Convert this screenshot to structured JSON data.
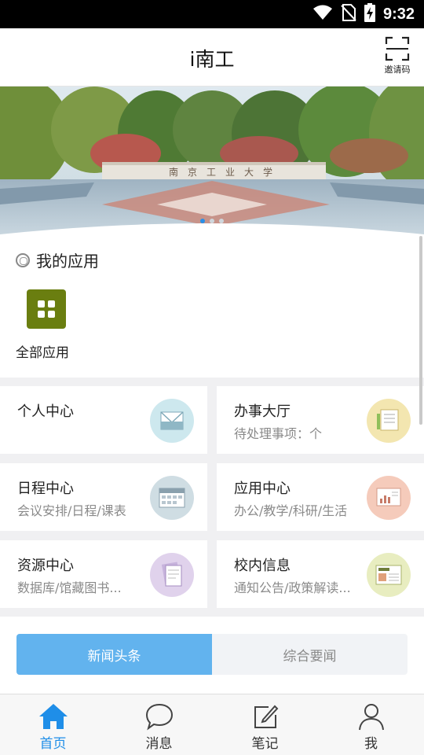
{
  "status_bar": {
    "time": "9:32"
  },
  "header": {
    "title": "i南工",
    "invite_label": "邀请码"
  },
  "banner": {
    "slide_count": 3,
    "active_index": 0
  },
  "my_apps": {
    "heading": "我的应用",
    "all_apps_label": "全部应用",
    "all_apps_color": "#6a7e10"
  },
  "cards": [
    {
      "title": "个人中心",
      "subtitle": "",
      "icon": "envelope-icon",
      "badge_color": "#cde8ee"
    },
    {
      "title": "办事大厅",
      "subtitle": "待处理事项：个",
      "icon": "documents-icon",
      "badge_color": "#f3e6b0"
    },
    {
      "title": "日程中心",
      "subtitle": "会议安排/日程/课表",
      "icon": "calendar-icon",
      "badge_color": "#cfdde3"
    },
    {
      "title": "应用中心",
      "subtitle": "办公/教学/科研/生活",
      "icon": "chart-board-icon",
      "badge_color": "#f5cbbb"
    },
    {
      "title": "资源中心",
      "subtitle": "数据库/馆藏图书...",
      "icon": "papers-icon",
      "badge_color": "#e0d2ec"
    },
    {
      "title": "校内信息",
      "subtitle": "通知公告/政策解读...",
      "icon": "newspaper-icon",
      "badge_color": "#e8edc0"
    }
  ],
  "news_tabs": [
    {
      "label": "新闻头条",
      "active": true
    },
    {
      "label": "综合要闻",
      "active": false
    }
  ],
  "bottom_nav": [
    {
      "label": "首页",
      "icon": "home-icon",
      "active": true
    },
    {
      "label": "消息",
      "icon": "chat-icon",
      "active": false
    },
    {
      "label": "笔记",
      "icon": "edit-note-icon",
      "active": false
    },
    {
      "label": "我",
      "icon": "user-icon",
      "active": false
    }
  ],
  "colors": {
    "accent": "#1f8ee8",
    "tab_active": "#62b3ee"
  }
}
